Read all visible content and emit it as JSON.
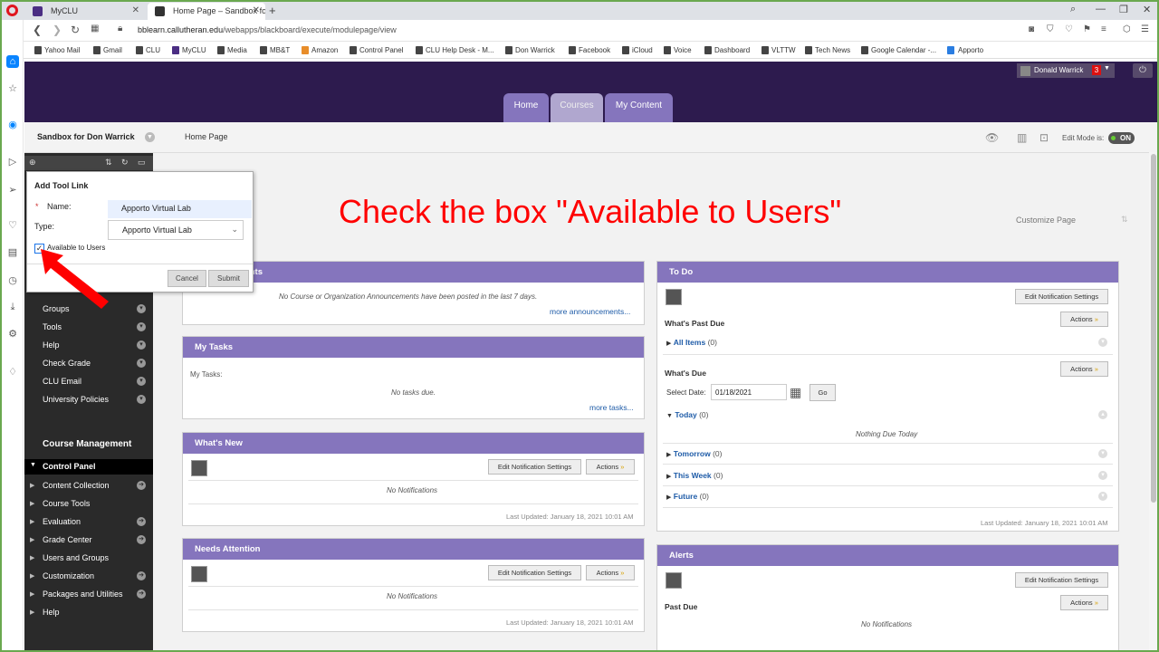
{
  "browser": {
    "tabs": [
      {
        "title": "MyCLU"
      },
      {
        "title": "Home Page – Sandbox for"
      }
    ],
    "url_host": "bblearn.callutheran.edu",
    "url_path": "/webapps/blackboard/execute/modulepage/view",
    "bookmarks": [
      "Yahoo Mail",
      "Gmail",
      "CLU",
      "MyCLU",
      "Media",
      "MB&T",
      "Amazon",
      "Control Panel",
      "CLU Help Desk - M...",
      "Don Warrick",
      "Facebook",
      "iCloud",
      "Voice",
      "Dashboard",
      "VLTTW",
      "Tech News",
      "Google Calendar -...",
      "Apporto"
    ]
  },
  "header": {
    "user_name": "Donald Warrick",
    "notification_count": "3",
    "tabs": [
      "Home",
      "Courses",
      "My Content"
    ]
  },
  "breadcrumb": {
    "course": "Sandbox for Don Warrick",
    "page": "Home Page",
    "edit_mode_label": "Edit Mode is:",
    "edit_mode_state": "ON"
  },
  "sidebar": {
    "items": [
      "Groups",
      "Tools",
      "Help",
      "Check Grade",
      "CLU Email",
      "University Policies"
    ],
    "management_heading": "Course Management",
    "control_panel": "Control Panel",
    "cp_items": [
      "Content Collection",
      "Course Tools",
      "Evaluation",
      "Grade Center",
      "Users and Groups",
      "Customization",
      "Packages and Utilities",
      "Help"
    ]
  },
  "add_tool": {
    "title": "Add Tool Link",
    "name_label": "Name:",
    "name_value": "Apporto Virtual Lab",
    "type_label": "Type:",
    "type_value": "Apporto Virtual Lab",
    "available_label": "Available to Users",
    "available_checked": true,
    "cancel": "Cancel",
    "submit": "Submit"
  },
  "annotation": {
    "text": "Check the box \"Available to Users\"",
    "color": "#ff0000"
  },
  "customize_page": "Customize Page",
  "modules": {
    "announcements": {
      "title_fragment": "ments",
      "empty": "No Course or Organization Announcements have been posted in the last 7 days.",
      "more": "more announcements..."
    },
    "my_tasks": {
      "title": "My Tasks",
      "label": "My Tasks:",
      "empty": "No tasks due.",
      "more": "more tasks..."
    },
    "whats_new": {
      "title": "What's New",
      "edit_btn": "Edit Notification Settings",
      "actions_btn": "Actions",
      "empty": "No Notifications",
      "updated": "Last Updated: January 18, 2021 10:01 AM"
    },
    "needs_attention": {
      "title": "Needs Attention",
      "edit_btn": "Edit Notification Settings",
      "actions_btn": "Actions",
      "empty": "No Notifications",
      "updated": "Last Updated: January 18, 2021 10:01 AM"
    },
    "todo": {
      "title": "To Do",
      "edit_btn": "Edit Notification Settings",
      "past_due_heading": "What's Past Due",
      "actions_btn": "Actions",
      "all_items": "All Items",
      "all_items_count": "(0)",
      "whats_due_heading": "What's Due",
      "select_date_label": "Select Date:",
      "date_value": "01/18/2021",
      "go": "Go",
      "today": "Today",
      "today_count": "(0)",
      "nothing_due": "Nothing Due Today",
      "tomorrow": "Tomorrow",
      "tomorrow_count": "(0)",
      "this_week": "This Week",
      "this_week_count": "(0)",
      "future": "Future",
      "future_count": "(0)",
      "updated": "Last Updated: January 18, 2021 10:01 AM"
    },
    "alerts": {
      "title": "Alerts",
      "edit_btn": "Edit Notification Settings",
      "past_due": "Past Due",
      "actions_btn": "Actions",
      "empty": "No Notifications"
    }
  }
}
